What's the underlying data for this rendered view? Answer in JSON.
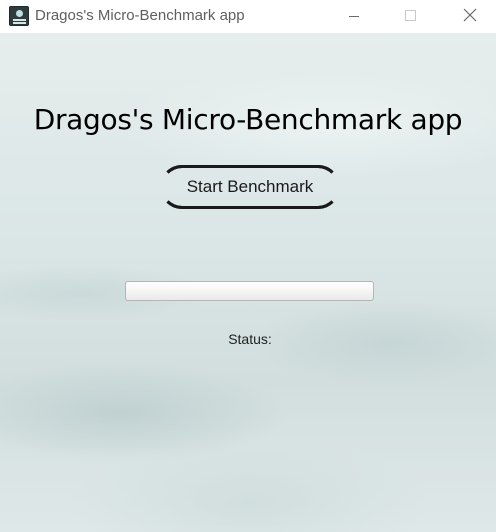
{
  "window": {
    "title": "Dragos's Micro-Benchmark app",
    "icon": "app-icon",
    "controls": {
      "minimize": "minimize-icon",
      "maximize": "maximize-icon",
      "close": "close-icon"
    }
  },
  "main": {
    "heading": "Dragos's Micro-Benchmark app",
    "start_button_label": "Start Benchmark",
    "progress_fraction": 0,
    "status_label": "Status:"
  },
  "colors": {
    "text": "#000000",
    "title_text": "#5f5f5f",
    "background": "#dbe6e6"
  }
}
